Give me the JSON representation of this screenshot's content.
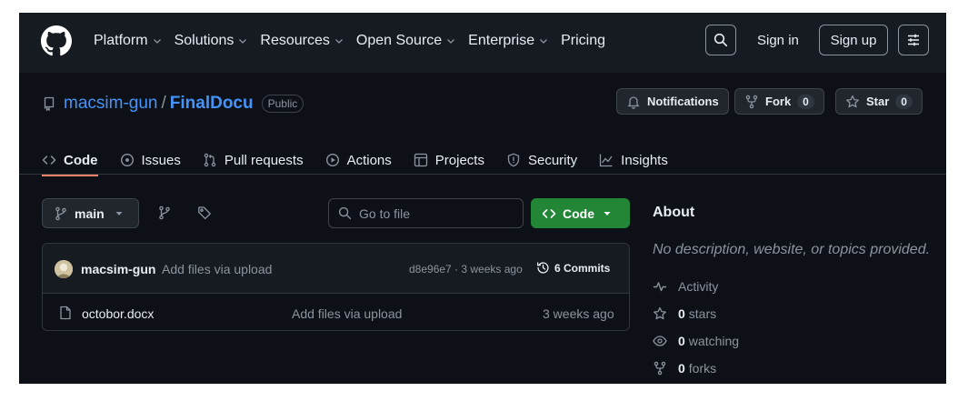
{
  "nav": {
    "items": [
      {
        "label": "Platform",
        "dropdown": true
      },
      {
        "label": "Solutions",
        "dropdown": true
      },
      {
        "label": "Resources",
        "dropdown": true
      },
      {
        "label": "Open Source",
        "dropdown": true
      },
      {
        "label": "Enterprise",
        "dropdown": true
      },
      {
        "label": "Pricing",
        "dropdown": false
      }
    ],
    "sign_in": "Sign in",
    "sign_up": "Sign up"
  },
  "repo": {
    "owner": "macsim-gun",
    "separator": "/",
    "name": "FinalDocu",
    "visibility": "Public",
    "notifications_label": "Notifications",
    "fork_label": "Fork",
    "fork_count": "0",
    "star_label": "Star",
    "star_count": "0"
  },
  "tabs": [
    {
      "label": "Code",
      "icon": "code-icon",
      "active": true
    },
    {
      "label": "Issues",
      "icon": "issue-icon"
    },
    {
      "label": "Pull requests",
      "icon": "pull-request-icon"
    },
    {
      "label": "Actions",
      "icon": "play-icon"
    },
    {
      "label": "Projects",
      "icon": "table-icon"
    },
    {
      "label": "Security",
      "icon": "shield-icon"
    },
    {
      "label": "Insights",
      "icon": "graph-icon"
    }
  ],
  "toolbar": {
    "branch": "main",
    "go_to_file_placeholder": "Go to file",
    "code_button": "Code"
  },
  "commit": {
    "author": "macsim-gun",
    "message": "Add files via upload",
    "meta": "d8e96e7 · 3 weeks ago",
    "commits_count": "6 Commits"
  },
  "files": [
    {
      "name": "octobor.docx",
      "message": "Add files via upload",
      "time": "3 weeks ago"
    }
  ],
  "about": {
    "title": "About",
    "description": "No description, website, or topics provided.",
    "activity": "Activity",
    "stars_count": "0",
    "stars_label": "stars",
    "watching_count": "0",
    "watching_label": "watching",
    "forks_count": "0",
    "forks_label": "forks"
  },
  "colors": {
    "background": "#0d1117",
    "header": "#161b22",
    "link": "#4493f8",
    "accent_green": "#238636",
    "active_tab_underline": "#f78166"
  }
}
